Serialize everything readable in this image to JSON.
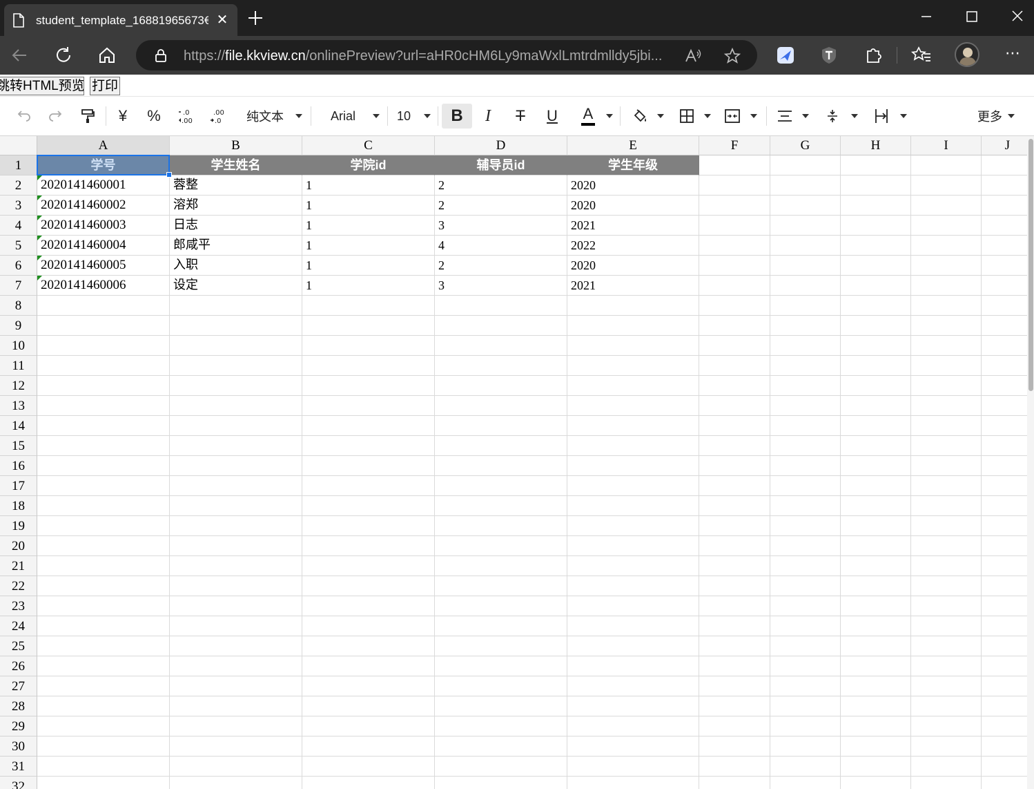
{
  "browser": {
    "tab_title": "student_template_16881965673€",
    "url_proto": "https://",
    "url_host": "file.kkview.cn",
    "url_rest": "/onlinePreview?url=aHR0cHM6Ly9maWxlLmtrdmlldy5jbi..."
  },
  "preview_bar": {
    "html_preview_label": "跳转HTML预览",
    "print_label": "打印"
  },
  "toolbar": {
    "currency_symbol": "¥",
    "percent_symbol": "%",
    "format_label": "纯文本",
    "font_name": "Arial",
    "font_size": "10",
    "bold_label": "B",
    "italic_label": "I",
    "strike_label": "T",
    "underline_label": "U",
    "font_color_label": "A",
    "more_label": "更多",
    "accent_color": "#1a73e8"
  },
  "sheet": {
    "columns": [
      "A",
      "B",
      "C",
      "D",
      "E",
      "F",
      "G",
      "H",
      "I",
      "J"
    ],
    "rows": [
      "1",
      "2",
      "3",
      "4",
      "5",
      "6",
      "7",
      "8",
      "9",
      "10",
      "11",
      "12",
      "13",
      "14",
      "15",
      "16",
      "17",
      "18",
      "19",
      "20",
      "21",
      "22",
      "23",
      "24",
      "25",
      "26",
      "27",
      "28",
      "29",
      "30",
      "31",
      "32"
    ],
    "header_cells": [
      "学号",
      "学生姓名",
      "学院id",
      "辅导员id",
      "学生年级"
    ],
    "data_rows": [
      [
        "2020141460001",
        "蓉整",
        "1",
        "2",
        "2020"
      ],
      [
        "2020141460002",
        "溶郑",
        "1",
        "2",
        "2020"
      ],
      [
        "2020141460003",
        "日志",
        "1",
        "3",
        "2021"
      ],
      [
        "2020141460004",
        "郎咸平",
        "1",
        "4",
        "2022"
      ],
      [
        "2020141460005",
        "入职",
        "1",
        "2",
        "2020"
      ],
      [
        "2020141460006",
        "设定",
        "1",
        "3",
        "2021"
      ]
    ],
    "selected_cell": "A1",
    "header_fill_color": "#808080"
  }
}
